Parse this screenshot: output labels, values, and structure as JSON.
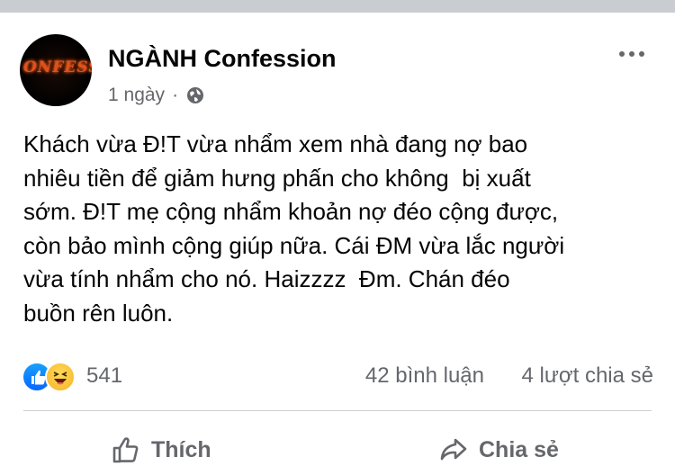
{
  "post": {
    "page_name": "NGÀNH Confession",
    "avatar_text": "ONFESSION",
    "time": "1 ngày",
    "separator": "·",
    "privacy_icon": "globe-icon",
    "more_icon": "more-horizontal-icon",
    "text": "Khách vừa Đ!T vừa nhẩm xem nhà đang nợ bao\nnhiêu tiền để giảm hưng phấn cho không  bị xuất\nsớm. Đ!T mẹ cộng nhẩm khoản nợ đéo cộng được,\ncòn bảo mình cộng giúp nữa. Cái ĐM vừa lắc người\nvừa tính nhẩm cho nó. Haizzzz  Đm. Chán đéo\nbuồn rên luôn."
  },
  "stats": {
    "reactions": [
      "like-reaction-icon",
      "haha-reaction-icon"
    ],
    "reaction_count": "541",
    "comments": "42 bình luận",
    "shares": "4 lượt chia sẻ"
  },
  "actions": {
    "like_label": "Thích",
    "like_icon": "thumbs-up-icon",
    "share_label": "Chia sẻ",
    "share_icon": "share-arrow-icon"
  },
  "colors": {
    "primary_text": "#050505",
    "secondary_text": "#65676b",
    "divider": "#ced0d4",
    "top_strip": "#c9ccd1",
    "like_blue": "#0866ff",
    "haha_yellow": "#f7b125",
    "avatar_flame": "#e2501c"
  }
}
